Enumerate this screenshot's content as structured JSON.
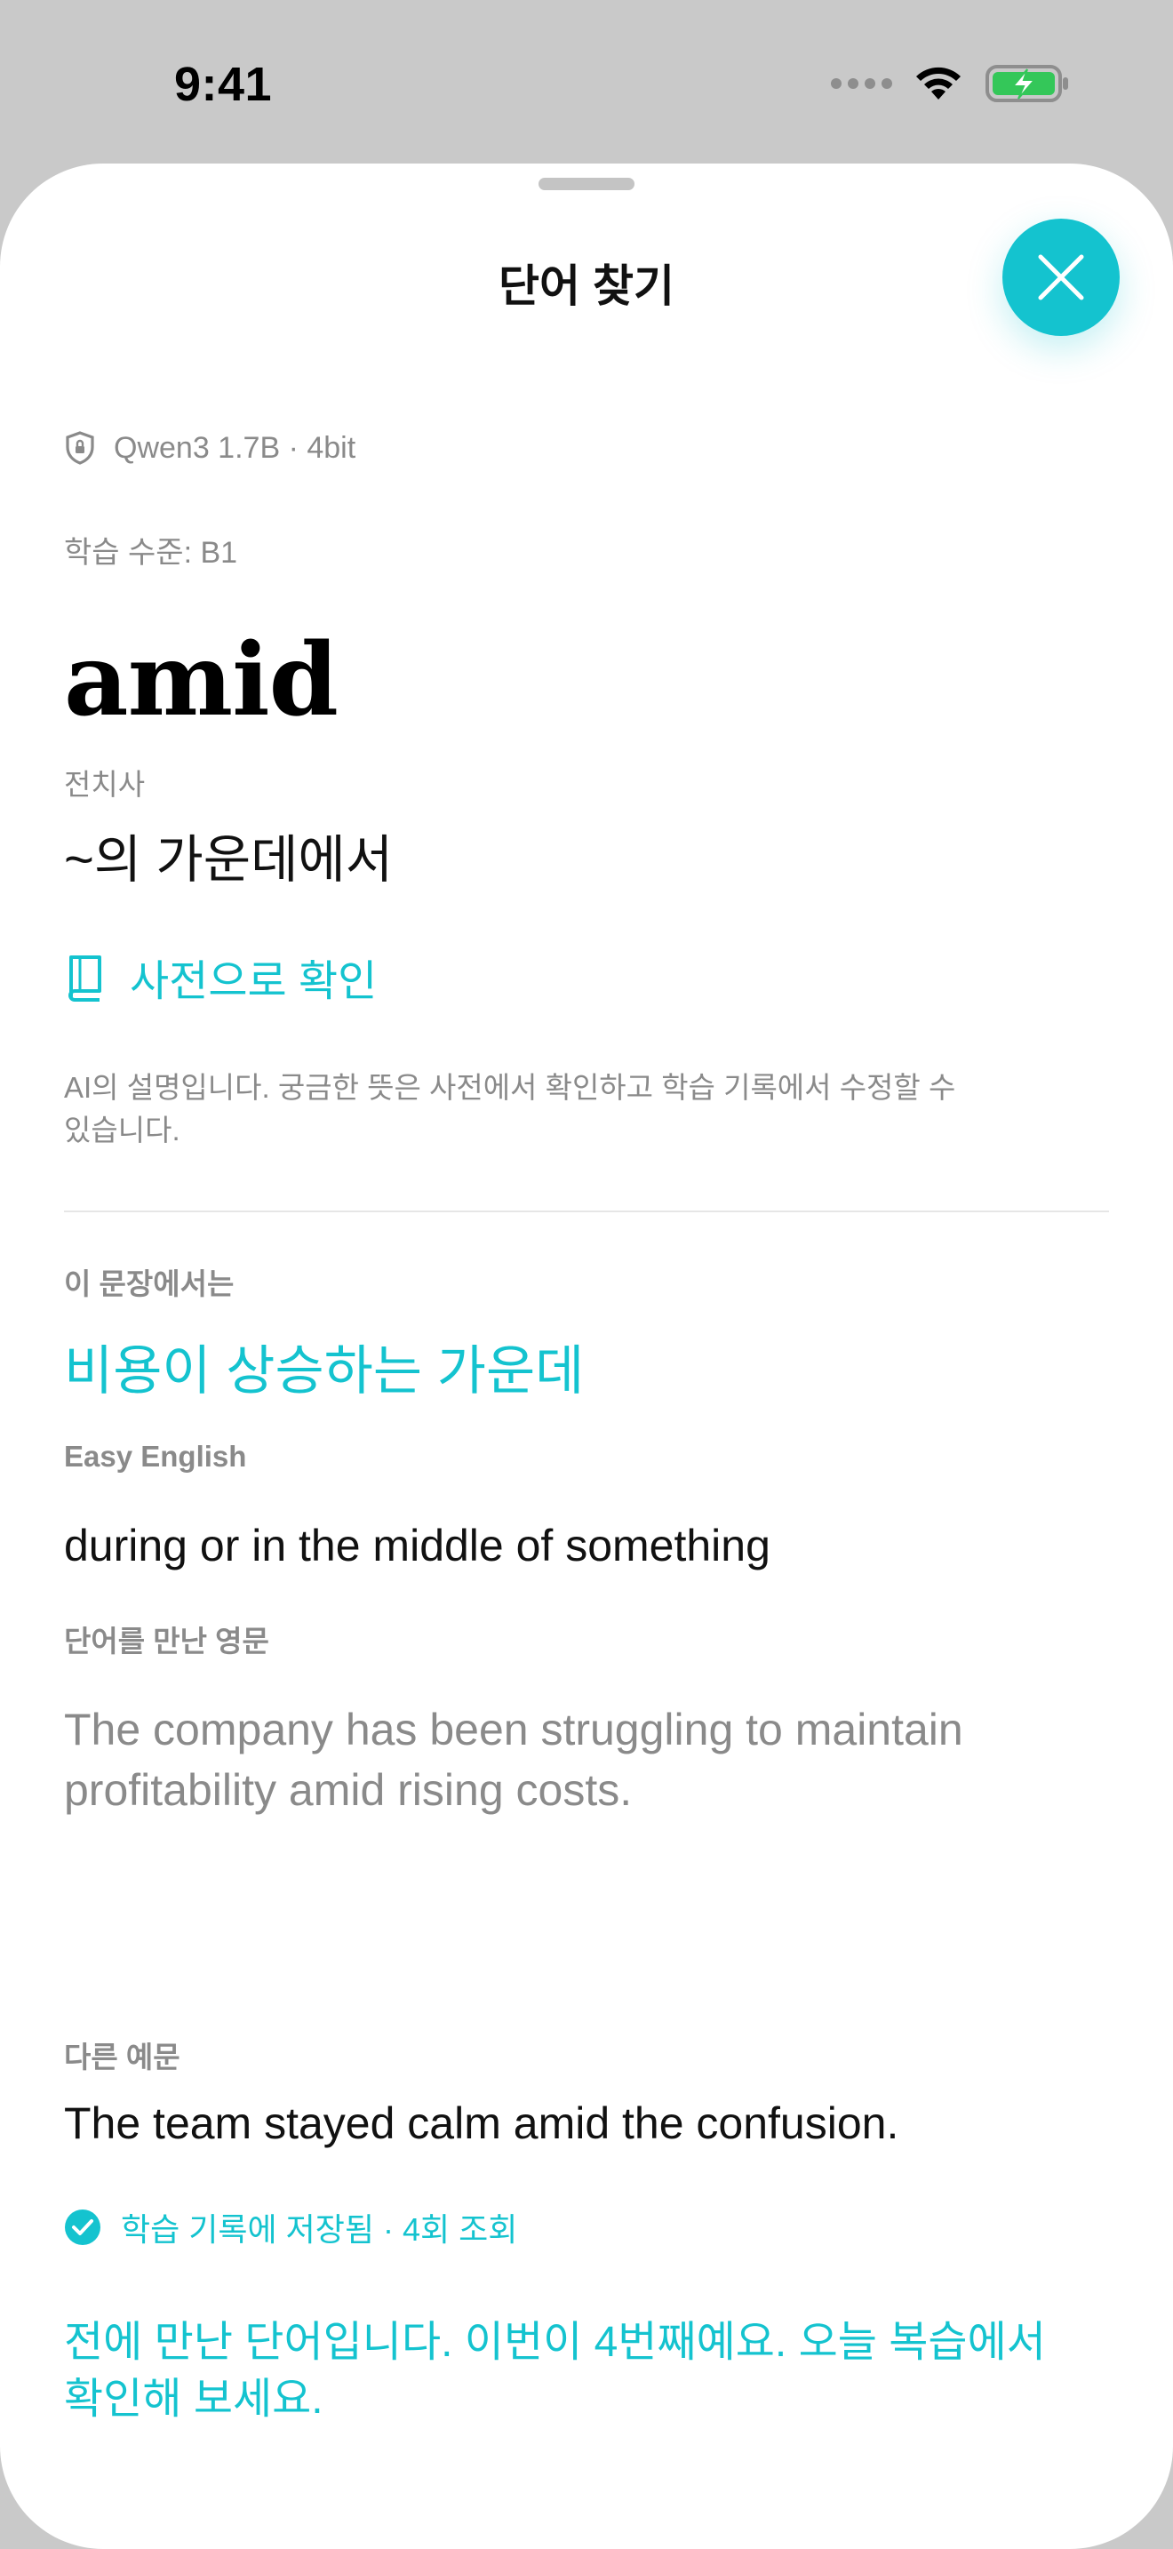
{
  "status_bar": {
    "time": "9:41"
  },
  "sheet": {
    "title": "단어 찾기"
  },
  "model": {
    "label": "Qwen3 1.7B · 4bit"
  },
  "level": {
    "label": "학습 수준: B1"
  },
  "entry": {
    "word": "amid",
    "part_of_speech": "전치사",
    "meaning": "~의 가운데에서"
  },
  "dictionary": {
    "label": "사전으로 확인"
  },
  "ai_note": "AI의 설명입니다. 궁금한 뜻은 사전에서 확인하고 학습 기록에서 수정할 수 있습니다.",
  "sections": {
    "context": {
      "label": "이 문장에서는",
      "value": "비용이 상승하는 가운데"
    },
    "easy_english": {
      "label": "Easy English",
      "value": "during or in the middle of something"
    },
    "source": {
      "label": "단어를 만난 영문",
      "value": "The company has been struggling to maintain profitability amid rising costs."
    },
    "other_example": {
      "label": "다른 예문",
      "value": "The team stayed calm amid the confusion."
    }
  },
  "saved": {
    "label": "학습 기록에 저장됨 · 4회 조회"
  },
  "review_note": "전에 만난 단어입니다. 이번이 4번째예요. 오늘 복습에서 확인해 보세요.",
  "colors": {
    "accent": "#14c3cf",
    "battery": "#34c759"
  }
}
